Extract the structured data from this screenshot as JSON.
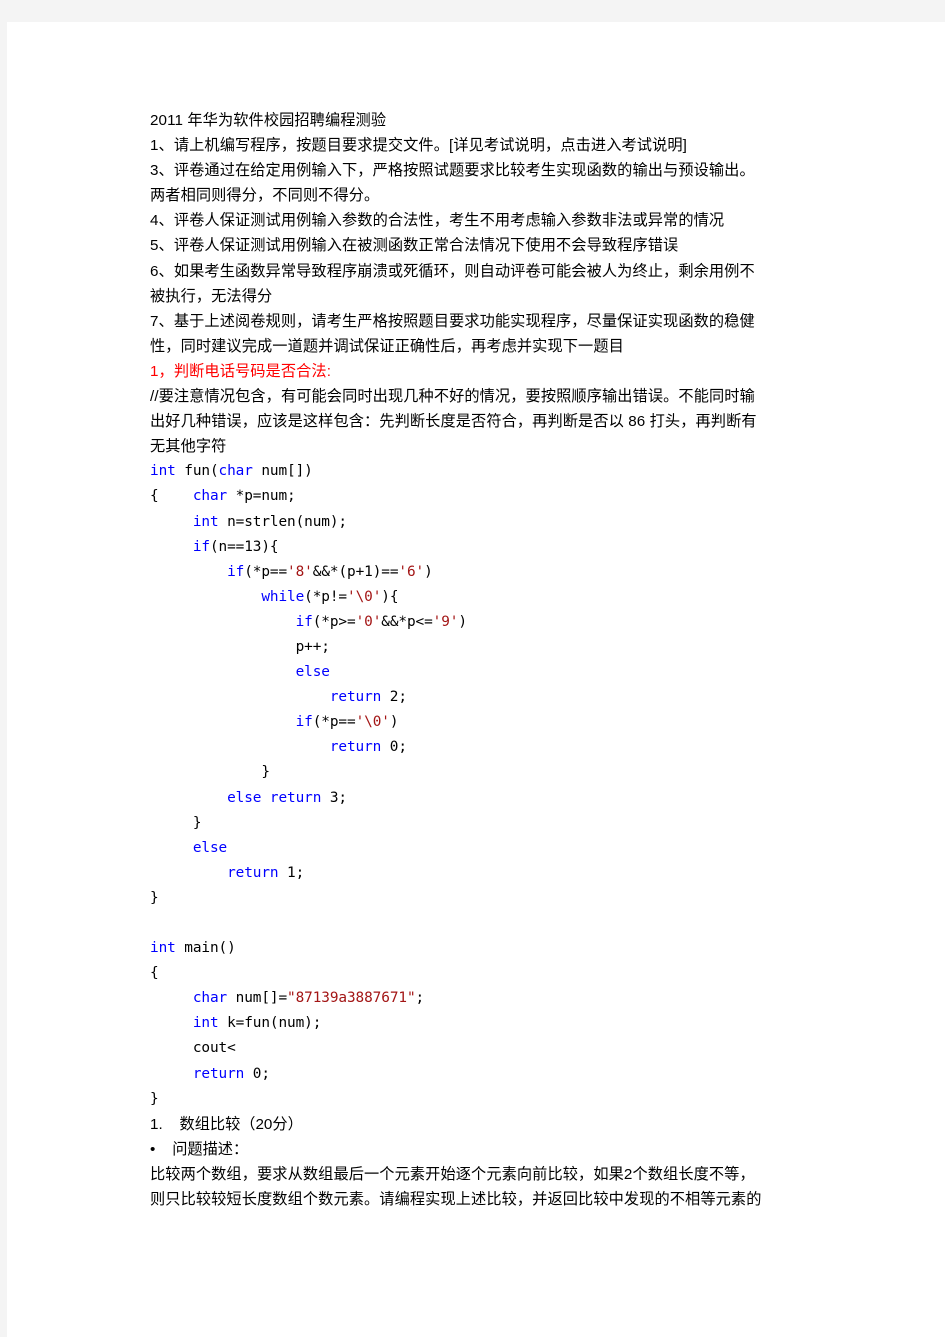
{
  "document": {
    "title_line": "2011 年华为软件校园招聘编程测验",
    "intro_lines": [
      "1、请上机编写程序，按题目要求提交文件。[详见考试说明，点击进入考试说明]",
      "3、评卷通过在给定用例输入下，严格按照试题要求比较考生实现函数的输出与预设输出。",
      "两者相同则得分，不同则不得分。",
      "4、评卷人保证测试用例输入参数的合法性，考生不用考虑输入参数非法或异常的情况",
      "5、评卷人保证测试用例输入在被测函数正常合法情况下使用不会导致程序错误",
      "6、如果考生函数异常导致程序崩溃或死循环，则自动评卷可能会被人为终止，剩余用例不",
      "被执行，无法得分",
      "7、基于上述阅卷规则，请考生严格按照题目要求功能实现程序，尽量保证实现函数的稳健",
      "性，同时建议完成一道题并调试保证正确性后，再考虑并实现下一题目"
    ],
    "section1_heading": "1，判断电话号码是否合法:",
    "section1_comment_lines": [
      "//要注意情况包含，有可能会同时出现几种不好的情况，要按照顺序输出错误。不能同时输",
      "出好几种错误，应该是这样包含：先判断长度是否符合，再判断是否以 86 打头，再判断有",
      "无其他字符"
    ],
    "code_lines": [
      [
        {
          "t": "int",
          "c": "kw"
        },
        {
          "t": " fun(",
          "c": ""
        },
        {
          "t": "char",
          "c": "kw"
        },
        {
          "t": " num[])",
          "c": ""
        }
      ],
      [
        {
          "t": "{    ",
          "c": ""
        },
        {
          "t": "char",
          "c": "kw"
        },
        {
          "t": " *p=num;",
          "c": ""
        }
      ],
      [
        {
          "t": "     ",
          "c": ""
        },
        {
          "t": "int",
          "c": "kw"
        },
        {
          "t": " n=strlen(num);",
          "c": ""
        }
      ],
      [
        {
          "t": "     ",
          "c": ""
        },
        {
          "t": "if",
          "c": "kw"
        },
        {
          "t": "(n==13){",
          "c": ""
        }
      ],
      [
        {
          "t": "         ",
          "c": ""
        },
        {
          "t": "if",
          "c": "kw"
        },
        {
          "t": "(*p==",
          "c": ""
        },
        {
          "t": "'8'",
          "c": "str"
        },
        {
          "t": "&&*(p+1)==",
          "c": ""
        },
        {
          "t": "'6'",
          "c": "str"
        },
        {
          "t": ")",
          "c": ""
        }
      ],
      [
        {
          "t": "             ",
          "c": ""
        },
        {
          "t": "while",
          "c": "kw"
        },
        {
          "t": "(*p!=",
          "c": ""
        },
        {
          "t": "'\\0'",
          "c": "str"
        },
        {
          "t": "){",
          "c": ""
        }
      ],
      [
        {
          "t": "                 ",
          "c": ""
        },
        {
          "t": "if",
          "c": "kw"
        },
        {
          "t": "(*p>=",
          "c": ""
        },
        {
          "t": "'0'",
          "c": "str"
        },
        {
          "t": "&&*p<=",
          "c": ""
        },
        {
          "t": "'9'",
          "c": "str"
        },
        {
          "t": ")",
          "c": ""
        }
      ],
      [
        {
          "t": "                 p++;",
          "c": ""
        }
      ],
      [
        {
          "t": "                 ",
          "c": ""
        },
        {
          "t": "else",
          "c": "kw"
        }
      ],
      [
        {
          "t": "                     ",
          "c": ""
        },
        {
          "t": "return",
          "c": "kw"
        },
        {
          "t": " 2;",
          "c": ""
        }
      ],
      [
        {
          "t": "                 ",
          "c": ""
        },
        {
          "t": "if",
          "c": "kw"
        },
        {
          "t": "(*p==",
          "c": ""
        },
        {
          "t": "'\\0'",
          "c": "str"
        },
        {
          "t": ")",
          "c": ""
        }
      ],
      [
        {
          "t": "                     ",
          "c": ""
        },
        {
          "t": "return",
          "c": "kw"
        },
        {
          "t": " 0;",
          "c": ""
        }
      ],
      [
        {
          "t": "             }",
          "c": ""
        }
      ],
      [
        {
          "t": "         ",
          "c": ""
        },
        {
          "t": "else return",
          "c": "kw"
        },
        {
          "t": " 3;",
          "c": ""
        }
      ],
      [
        {
          "t": "     }",
          "c": ""
        }
      ],
      [
        {
          "t": "     ",
          "c": ""
        },
        {
          "t": "else",
          "c": "kw"
        }
      ],
      [
        {
          "t": "         ",
          "c": ""
        },
        {
          "t": "return",
          "c": "kw"
        },
        {
          "t": " 1;",
          "c": ""
        }
      ],
      [
        {
          "t": "}",
          "c": ""
        }
      ],
      [],
      [
        {
          "t": "int",
          "c": "kw"
        },
        {
          "t": " main()",
          "c": ""
        }
      ],
      [
        {
          "t": "{",
          "c": ""
        }
      ],
      [
        {
          "t": "     ",
          "c": ""
        },
        {
          "t": "char",
          "c": "kw"
        },
        {
          "t": " num[]=",
          "c": ""
        },
        {
          "t": "\"87139a3887671\"",
          "c": "str"
        },
        {
          "t": ";",
          "c": ""
        }
      ],
      [
        {
          "t": "     ",
          "c": ""
        },
        {
          "t": "int",
          "c": "kw"
        },
        {
          "t": " k=fun(num);",
          "c": ""
        }
      ],
      [
        {
          "t": "     cout<",
          "c": ""
        }
      ],
      [
        {
          "t": "     ",
          "c": ""
        },
        {
          "t": "return",
          "c": "kw"
        },
        {
          "t": " 0;",
          "c": ""
        }
      ],
      [
        {
          "t": "}",
          "c": ""
        }
      ]
    ],
    "question_number": "1.    数组比较（20分）",
    "question_bullet": "•    问题描述：",
    "question_body_lines": [
      "比较两个数组，要求从数组最后一个元素开始逐个元素向前比较，如果2个数组长度不等，",
      "则只比较较短长度数组个数元素。请编程实现上述比较，并返回比较中发现的不相等元素的"
    ]
  },
  "colors": {
    "page_background": "#ffffff",
    "outer_background": "#f4f4f4",
    "body_text": "#000000",
    "heading_red": "#ff0000",
    "code_keyword": "#0000ff",
    "code_string": "#a31515"
  }
}
